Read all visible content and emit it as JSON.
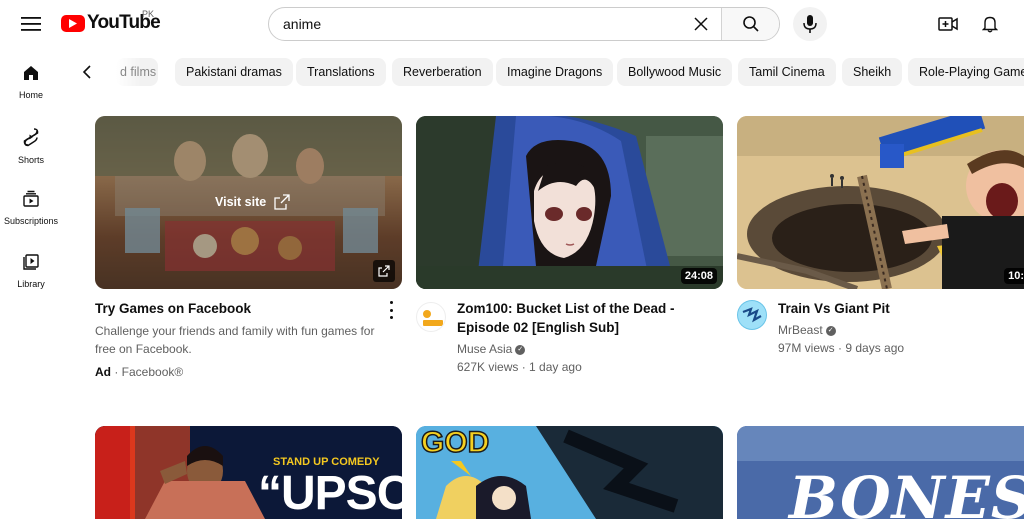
{
  "header": {
    "logo_text": "YouTube",
    "country_code": "PK",
    "search_value": "anime"
  },
  "sidebar": {
    "items": [
      {
        "label": "Home",
        "icon": "home-icon"
      },
      {
        "label": "Shorts",
        "icon": "shorts-icon"
      },
      {
        "label": "Subscriptions",
        "icon": "subscriptions-icon"
      },
      {
        "label": "Library",
        "icon": "library-icon"
      }
    ]
  },
  "chips": [
    "d films",
    "Pakistani dramas",
    "Translations",
    "Reverberation",
    "Imagine Dragons",
    "Bollywood Music",
    "Tamil Cinema",
    "Sheikh",
    "Role-Playing Game"
  ],
  "videos": [
    {
      "title": "Try Games on Facebook",
      "description": "Challenge your friends and family with fun games for free on Facebook.",
      "ad_label": "Ad",
      "advertiser": "· Facebook®",
      "overlay": "Visit site"
    },
    {
      "title": "Zom100: Bucket List of the Dead - Episode 02 [English Sub]",
      "channel": "Muse Asia",
      "stats": "627K views · 1 day ago",
      "duration": "24:08"
    },
    {
      "title": "Train Vs Giant Pit",
      "channel": "MrBeast",
      "stats": "97M views · 9 days ago",
      "duration": "10:"
    }
  ],
  "row2": {
    "thumb1_line1": "STAND UP COMEDY",
    "thumb1_line2": "“UPSC”",
    "thumb2_text": "GOD",
    "thumb3_text": "BONES"
  },
  "colors": {
    "brand_red": "#ff0000",
    "chip_bg": "#f2f2f2",
    "text_secondary": "#606060"
  }
}
